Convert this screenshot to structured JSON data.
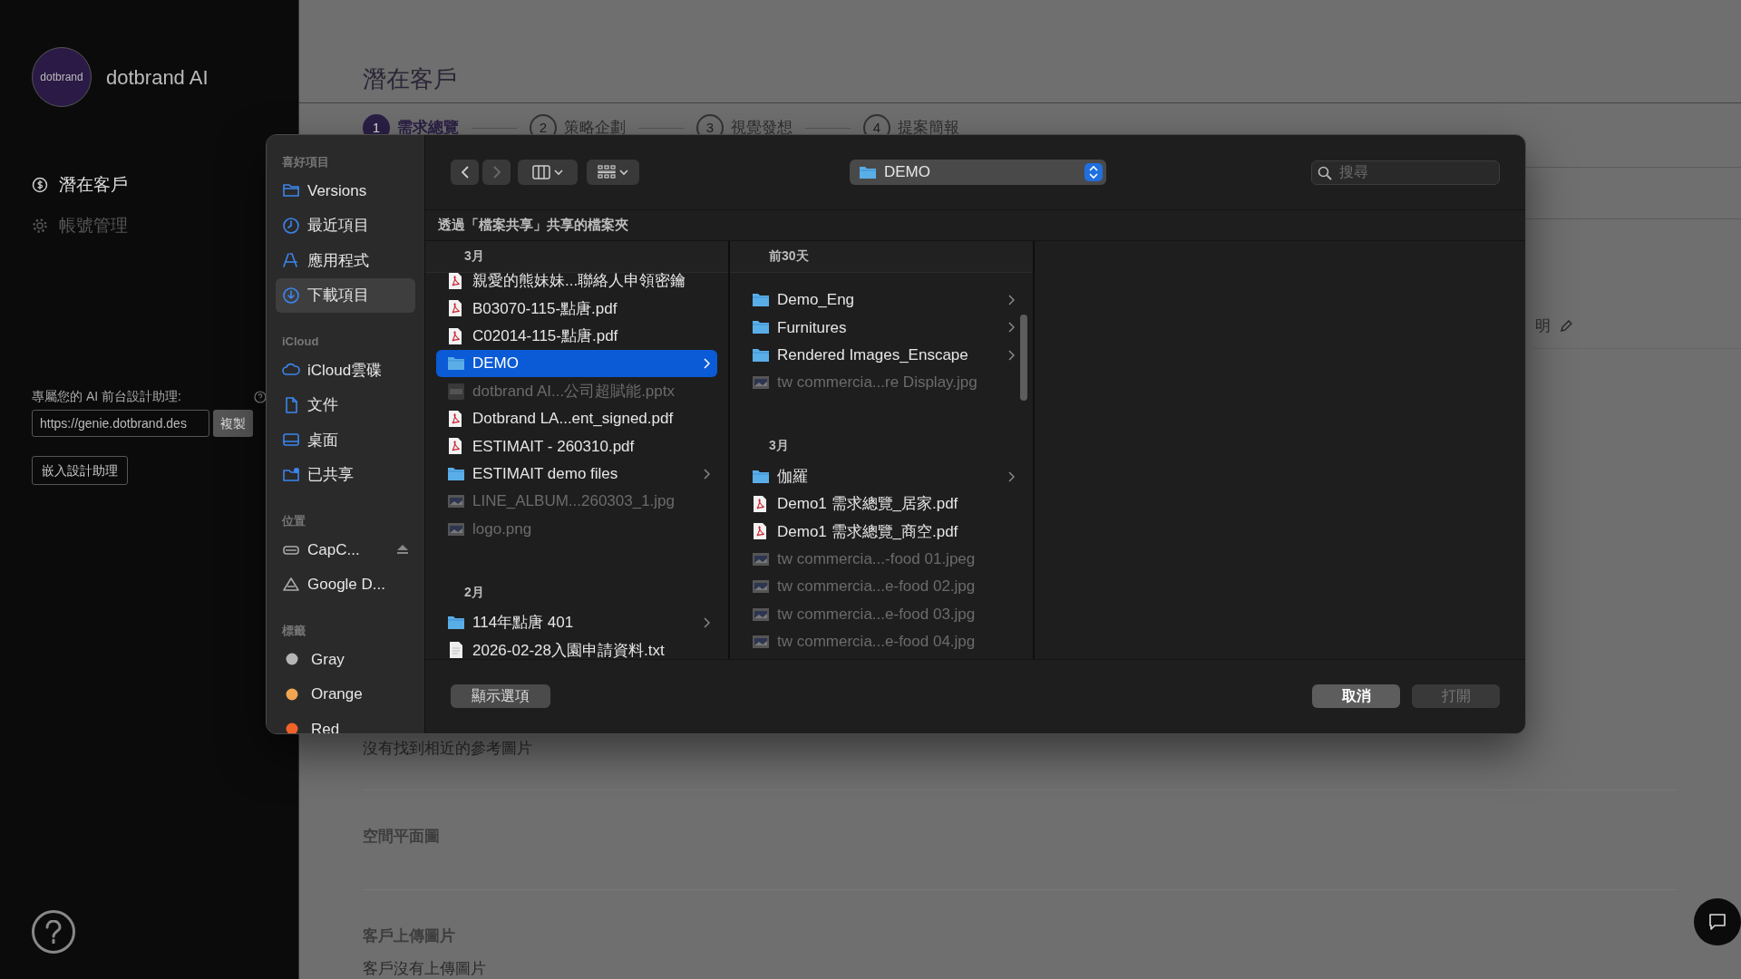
{
  "app": {
    "logo_text": "dotbrand",
    "name": "dotbrand AI"
  },
  "nav": [
    {
      "label": "潛在客戶",
      "kind": "dollar",
      "selected": true
    },
    {
      "label": "帳號管理",
      "kind": "gear",
      "selected": false
    }
  ],
  "assistant": {
    "label": "專屬您的 AI 前台設計助理:",
    "url": "https://genie.dotbrand.des",
    "copy_button": "複製",
    "embed_button": "嵌入設計助理"
  },
  "page": {
    "title": "潛在客戶",
    "steps": [
      {
        "number": "1",
        "label": "需求總覽",
        "selected": true
      },
      {
        "number": "2",
        "label": "策略企劃",
        "selected": false
      },
      {
        "number": "3",
        "label": "視覺發想",
        "selected": false
      },
      {
        "number": "4",
        "label": "提案簡報",
        "selected": false
      }
    ],
    "side_text": "明",
    "sections": [
      {
        "kind": "note",
        "text": "沒有找到相近的參考圖片"
      },
      {
        "kind": "heading",
        "text": "空間平面圖"
      },
      {
        "kind": "heading",
        "text": "客戶上傳圖片"
      },
      {
        "kind": "note",
        "text": "客戶沒有上傳圖片"
      }
    ]
  },
  "dialog": {
    "sidebar": [
      {
        "header": "喜好項目",
        "items": [
          {
            "label": "Versions",
            "kind": "folder",
            "selected": false
          },
          {
            "label": "最近項目",
            "kind": "recents",
            "selected": false
          },
          {
            "label": "應用程式",
            "kind": "applications",
            "selected": false
          },
          {
            "label": "下載項目",
            "kind": "downloads",
            "selected": true
          }
        ]
      },
      {
        "header": "iCloud",
        "items": [
          {
            "label": "iCloud雲碟",
            "kind": "icloud",
            "selected": false
          },
          {
            "label": "文件",
            "kind": "documents",
            "selected": false
          },
          {
            "label": "桌面",
            "kind": "desktop",
            "selected": false
          },
          {
            "label": "已共享",
            "kind": "shared",
            "selected": false
          }
        ]
      },
      {
        "header": "位置",
        "items": [
          {
            "label": "CapC...",
            "kind": "disk",
            "selected": false,
            "eject": true
          },
          {
            "label": "Google D...",
            "kind": "google-drive",
            "selected": false
          }
        ]
      },
      {
        "header": "標籤",
        "items": [
          {
            "label": "Gray",
            "kind": "tag",
            "color": "#b5b5b5",
            "selected": false
          },
          {
            "label": "Orange",
            "kind": "tag",
            "color": "#f0a650",
            "selected": false
          },
          {
            "label": "Red",
            "kind": "tag",
            "color": "#f0622a",
            "selected": false
          }
        ]
      }
    ],
    "path": "DEMO",
    "search": {
      "placeholder": "搜尋"
    },
    "share_note": "透過「檔案共享」共享的檔案夾",
    "columns": [
      {
        "groups": [
          {
            "label": "3月",
            "items": [
              {
                "name": "親愛的熊妹妹...聯絡人申領密鑰",
                "kind": "pdf",
                "selected": false,
                "disabled": false,
                "partly_hidden": true
              },
              {
                "name": "B03070-115-點唐.pdf",
                "kind": "pdf",
                "selected": false,
                "disabled": false
              },
              {
                "name": "C02014-115-點唐.pdf",
                "kind": "pdf",
                "selected": false,
                "disabled": false
              },
              {
                "name": "DEMO",
                "kind": "folder",
                "selected": true,
                "disabled": false
              },
              {
                "name": "dotbrand AI...公司超賦能.pptx",
                "kind": "slides",
                "selected": false,
                "disabled": true
              },
              {
                "name": "Dotbrand LA...ent_signed.pdf",
                "kind": "pdf",
                "selected": false,
                "disabled": false
              },
              {
                "name": "ESTIMAIT - 260310.pdf",
                "kind": "pdf",
                "selected": false,
                "disabled": false
              },
              {
                "name": "ESTIMAIT demo files",
                "kind": "folder",
                "selected": false,
                "disabled": false
              },
              {
                "name": "LINE_ALBUM...260303_1.jpg",
                "kind": "image",
                "selected": false,
                "disabled": true
              },
              {
                "name": "logo.png",
                "kind": "image",
                "selected": false,
                "disabled": true
              }
            ]
          },
          {
            "label": "2月",
            "items": [
              {
                "name": "114年點唐 401",
                "kind": "folder",
                "selected": false,
                "disabled": false
              },
              {
                "name": "2026-02-28入園申請資料.txt",
                "kind": "text",
                "selected": false,
                "disabled": false
              }
            ]
          }
        ]
      },
      {
        "groups": [
          {
            "label": "前30天",
            "items": [
              {
                "name": "Demo_Eng",
                "kind": "folder",
                "selected": false,
                "disabled": false
              },
              {
                "name": "Furnitures",
                "kind": "folder",
                "selected": false,
                "disabled": false
              },
              {
                "name": "Rendered Images_Enscape",
                "kind": "folder",
                "selected": false,
                "disabled": false
              },
              {
                "name": "tw commercia...re Display.jpg",
                "kind": "image",
                "selected": false,
                "disabled": true
              }
            ]
          },
          {
            "label": "3月",
            "items": [
              {
                "name": "伽羅",
                "kind": "folder",
                "selected": false,
                "disabled": false
              },
              {
                "name": "Demo1 需求總覽_居家.pdf",
                "kind": "pdf",
                "selected": false,
                "disabled": false
              },
              {
                "name": "Demo1 需求總覽_商空.pdf",
                "kind": "pdf",
                "selected": false,
                "disabled": false
              },
              {
                "name": "tw commercia...-food 01.jpeg",
                "kind": "image",
                "selected": false,
                "disabled": true
              },
              {
                "name": "tw commercia...e-food 02.jpg",
                "kind": "image",
                "selected": false,
                "disabled": true
              },
              {
                "name": "tw commercia...e-food 03.jpg",
                "kind": "image",
                "selected": false,
                "disabled": true
              },
              {
                "name": "tw commercia...e-food 04.jpg",
                "kind": "image",
                "selected": false,
                "disabled": true
              }
            ]
          }
        ]
      }
    ],
    "options_button": "顯示選項",
    "cancel_button": "取消",
    "open_button": {
      "label": "打開",
      "disabled": true
    }
  }
}
